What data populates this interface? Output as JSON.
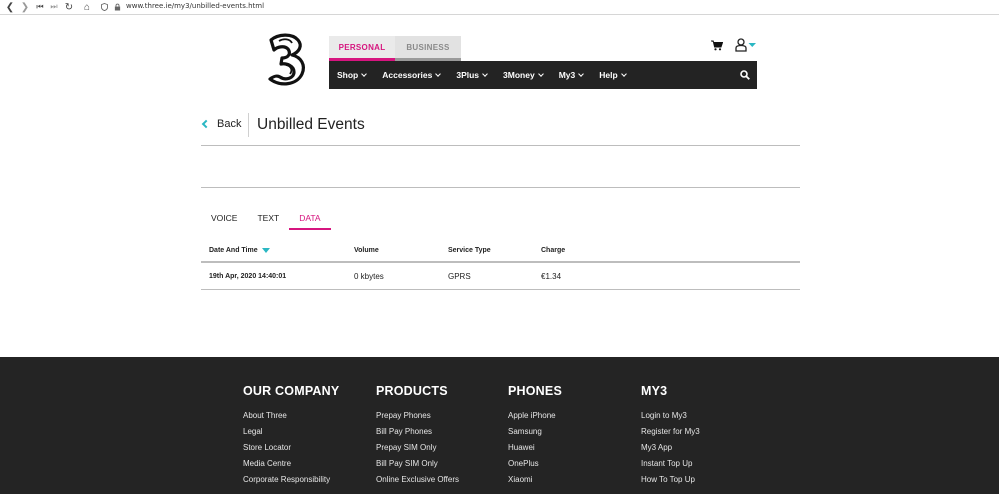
{
  "browser": {
    "url": "www.three.ie/my3/unbilled-events.html"
  },
  "header": {
    "segments": [
      {
        "label": "PERSONAL",
        "active": true
      },
      {
        "label": "BUSINESS",
        "active": false
      }
    ],
    "nav": [
      {
        "label": "Shop"
      },
      {
        "label": "Accessories"
      },
      {
        "label": "3Plus"
      },
      {
        "label": "3Money"
      },
      {
        "label": "My3"
      },
      {
        "label": "Help"
      }
    ]
  },
  "page": {
    "back_label": "Back",
    "title": "Unbilled Events"
  },
  "tabs": [
    {
      "label": "VOICE",
      "active": false
    },
    {
      "label": "TEXT",
      "active": false
    },
    {
      "label": "DATA",
      "active": true
    }
  ],
  "table": {
    "headers": [
      "Date And Time",
      "Volume",
      "Service Type",
      "Charge"
    ],
    "rows": [
      {
        "date": "19th Apr, 2020 14:40:01",
        "volume": "0 kbytes",
        "service": "GPRS",
        "charge": "€1.34"
      }
    ]
  },
  "footer": {
    "columns": [
      {
        "title": "OUR COMPANY",
        "links": [
          "About Three",
          "Legal",
          "Store Locator",
          "Media Centre",
          "Corporate Responsibility"
        ]
      },
      {
        "title": "PRODUCTS",
        "links": [
          "Prepay Phones",
          "Bill Pay Phones",
          "Prepay SIM Only",
          "Bill Pay SIM Only",
          "Online Exclusive Offers"
        ]
      },
      {
        "title": "PHONES",
        "links": [
          "Apple iPhone",
          "Samsung",
          "Huawei",
          "OnePlus",
          "Xiaomi"
        ]
      },
      {
        "title": "MY3",
        "links": [
          "Login to My3",
          "Register for My3",
          "My3 App",
          "Instant Top Up",
          "How To Top Up"
        ]
      }
    ]
  },
  "colors": {
    "brand_pink": "#d6157f",
    "accent_teal": "#2ab7c3",
    "nav_dark": "#232323",
    "footer_dark": "#242424"
  }
}
